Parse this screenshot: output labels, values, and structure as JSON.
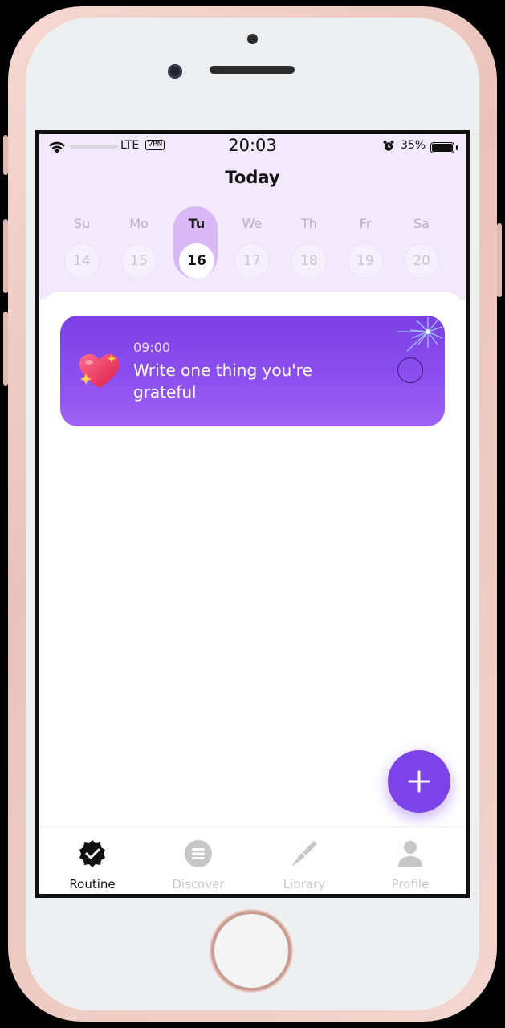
{
  "status_bar": {
    "network": "LTE",
    "vpn": "VPN",
    "time": "20:03",
    "battery": "35%"
  },
  "header": {
    "title": "Today"
  },
  "week": [
    {
      "name": "Su",
      "num": "14",
      "active": false
    },
    {
      "name": "Mo",
      "num": "15",
      "active": false
    },
    {
      "name": "Tu",
      "num": "16",
      "active": true
    },
    {
      "name": "We",
      "num": "17",
      "active": false
    },
    {
      "name": "Th",
      "num": "18",
      "active": false
    },
    {
      "name": "Fr",
      "num": "19",
      "active": false
    },
    {
      "name": "Sa",
      "num": "20",
      "active": false
    }
  ],
  "task": {
    "time": "09:00",
    "text": "Write one thing you're grateful",
    "icon": "heart-sparkle-icon"
  },
  "fab": {
    "icon": "plus-icon"
  },
  "tabs": [
    {
      "label": "Routine",
      "icon": "verified-check-icon",
      "active": true
    },
    {
      "label": "Discover",
      "icon": "list-icon",
      "active": false
    },
    {
      "label": "Library",
      "icon": "brush-icon",
      "active": false
    },
    {
      "label": "Profile",
      "icon": "person-icon",
      "active": false
    }
  ],
  "colors": {
    "accent": "#7c44e8",
    "header_bg": "#f3e9fd",
    "active_day_pill": "#d9b9f5"
  }
}
